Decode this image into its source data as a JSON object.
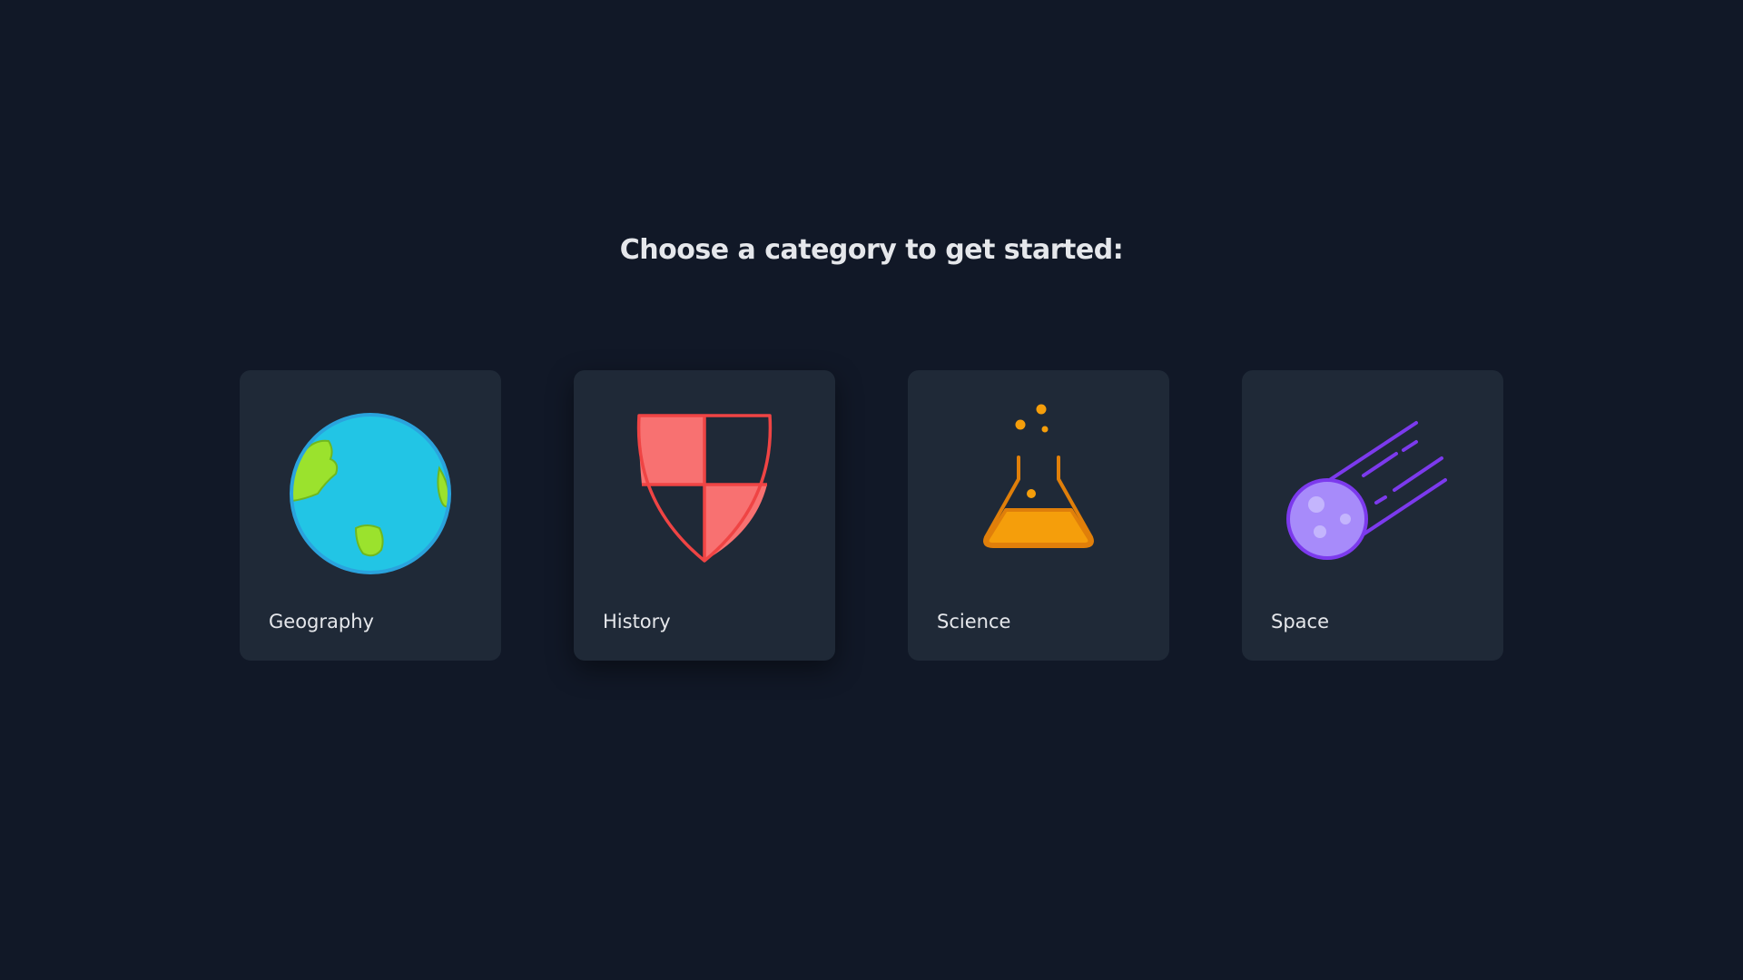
{
  "prompt": "Choose a category to get started:",
  "categories": [
    {
      "label": "Geography",
      "icon": "globe-icon",
      "color": "#22c5e5"
    },
    {
      "label": "History",
      "icon": "shield-icon",
      "color": "#ef4444"
    },
    {
      "label": "Science",
      "icon": "flask-icon",
      "color": "#f59e0b"
    },
    {
      "label": "Space",
      "icon": "comet-icon",
      "color": "#7c3aed"
    }
  ],
  "colors": {
    "background": "#111827",
    "card": "#1f2937",
    "text": "#e5e7eb"
  }
}
